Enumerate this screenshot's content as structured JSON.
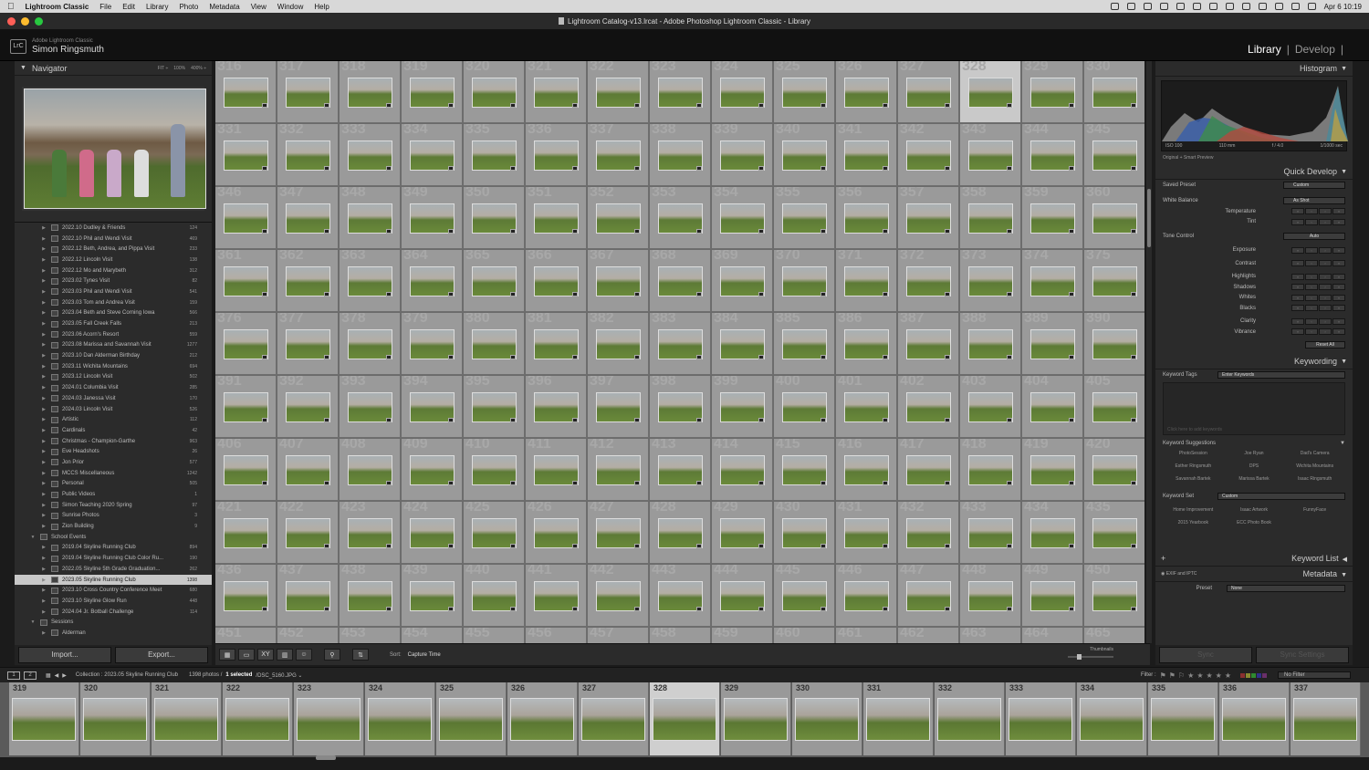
{
  "macbar": {
    "app": "Lightroom Classic",
    "menus": [
      "File",
      "Edit",
      "Library",
      "Photo",
      "Metadata",
      "View",
      "Window",
      "Help"
    ],
    "clock": "Apr 6  10:19"
  },
  "window": {
    "title": "Lightroom Catalog-v13.lrcat - Adobe Photoshop Lightroom Classic - Library"
  },
  "identity": {
    "product": "Adobe Lightroom Classic",
    "user": "Simon Ringsmuth",
    "badge": "LrC"
  },
  "modules": {
    "library": "Library",
    "sep": "|",
    "develop": "Develop",
    "sep2": "|"
  },
  "navigator": {
    "title": "Navigator",
    "zoom": [
      "FIT ÷",
      "100%",
      "400% ÷"
    ]
  },
  "collections": [
    {
      "name": "2022.10 Dudley & Friends",
      "count": "124",
      "level": 1,
      "tri": "▶"
    },
    {
      "name": "2022.10 Phil and Wendi Visit",
      "count": "469",
      "level": 1,
      "tri": "▶"
    },
    {
      "name": "2022.12 Beth, Andrea, and Pippa Visit",
      "count": "233",
      "level": 1,
      "tri": "▶"
    },
    {
      "name": "2022.12 Lincoln Visit",
      "count": "138",
      "level": 1,
      "tri": "▶"
    },
    {
      "name": "2022.12 Mo and Marybeth",
      "count": "312",
      "level": 1,
      "tri": "▶"
    },
    {
      "name": "2023.02 Tynes Visit",
      "count": "82",
      "level": 1,
      "tri": "▶"
    },
    {
      "name": "2023.03 Phil and Wendi Visit",
      "count": "541",
      "level": 1,
      "tri": "▶"
    },
    {
      "name": "2023.03 Tom and Andrea Visit",
      "count": "159",
      "level": 1,
      "tri": "▶"
    },
    {
      "name": "2023.04 Beth and Steve Corning Iowa",
      "count": "566",
      "level": 1,
      "tri": "▶"
    },
    {
      "name": "2023.05 Fall Creek Falls",
      "count": "213",
      "level": 1,
      "tri": "▶"
    },
    {
      "name": "2023.06 Acorn's Resort",
      "count": "559",
      "level": 1,
      "tri": "▶"
    },
    {
      "name": "2023.08 Marissa and Savannah Visit",
      "count": "1277",
      "level": 1,
      "tri": "▶"
    },
    {
      "name": "2023.10 Dan Alderman Birthday",
      "count": "212",
      "level": 1,
      "tri": "▶"
    },
    {
      "name": "2023.11 Wichita Mountains",
      "count": "694",
      "level": 1,
      "tri": "▶"
    },
    {
      "name": "2023.12 Lincoln Visit",
      "count": "502",
      "level": 1,
      "tri": "▶"
    },
    {
      "name": "2024.01 Columbia Visit",
      "count": "285",
      "level": 1,
      "tri": "▶"
    },
    {
      "name": "2024.03 Janessa Visit",
      "count": "170",
      "level": 1,
      "tri": "▶"
    },
    {
      "name": "2024.03 Lincoln Visit",
      "count": "526",
      "level": 1,
      "tri": "▶"
    },
    {
      "name": "Artistic",
      "count": "112",
      "level": 1,
      "tri": "▶"
    },
    {
      "name": "Cardinals",
      "count": "42",
      "level": 1,
      "tri": "▶"
    },
    {
      "name": "Christmas - Champion-Garthe",
      "count": "963",
      "level": 1,
      "tri": "▶"
    },
    {
      "name": "Eve Headshots",
      "count": "26",
      "level": 1,
      "tri": "▶"
    },
    {
      "name": "Jon Prior",
      "count": "577",
      "level": 1,
      "tri": "▶"
    },
    {
      "name": "MCCS Miscellaneous",
      "count": "1242",
      "level": 1,
      "tri": "▶"
    },
    {
      "name": "Personal",
      "count": "505",
      "level": 1,
      "tri": "▶"
    },
    {
      "name": "Public Videos",
      "count": "1",
      "level": 1,
      "tri": "▶"
    },
    {
      "name": "Simon Teaching 2020 Spring",
      "count": "97",
      "level": 1,
      "tri": "▶"
    },
    {
      "name": "Sunrise Photos",
      "count": "3",
      "level": 1,
      "tri": "▶"
    },
    {
      "name": "Zion Building",
      "count": "9",
      "level": 1,
      "tri": "▶"
    },
    {
      "name": "School Events",
      "count": "",
      "level": 0,
      "tri": "▼"
    },
    {
      "name": "2019.04 Skyline Running Club",
      "count": "894",
      "level": 1,
      "tri": "▶"
    },
    {
      "name": "2019.04 Skyline Running Club Color Ru...",
      "count": "190",
      "level": 1,
      "tri": "▶"
    },
    {
      "name": "2022.05 Skyline 5th Grade Graduation...",
      "count": "262",
      "level": 1,
      "tri": "▶"
    },
    {
      "name": "2023.05 Skyline Running Club",
      "count": "1398",
      "level": 1,
      "tri": "▶",
      "selected": true
    },
    {
      "name": "2023.10 Cross Country Conference Meet",
      "count": "680",
      "level": 1,
      "tri": "▶"
    },
    {
      "name": "2023.10 Skyline Glow Run",
      "count": "448",
      "level": 1,
      "tri": "▶"
    },
    {
      "name": "2024.04 Jr. Botball Challenge",
      "count": "114",
      "level": 1,
      "tri": "▶"
    },
    {
      "name": "Sessions",
      "count": "",
      "level": 0,
      "tri": "▼"
    },
    {
      "name": "Alderman",
      "count": "",
      "level": 1,
      "tri": "▶"
    }
  ],
  "left_buttons": {
    "import": "Import...",
    "export": "Export..."
  },
  "grid": {
    "start": 316,
    "cols": 15,
    "rows": 10,
    "selected": 328
  },
  "toolbar": {
    "sort_label": "Sort:",
    "sort_value": "Capture Time",
    "thumbs_label": "Thumbnails"
  },
  "histogram": {
    "title": "Histogram",
    "iso": "ISO 100",
    "focal": "110 mm",
    "aperture": "f / 4.0",
    "shutter": "1/1000 sec",
    "preview": "Original + Smart Preview"
  },
  "quick_develop": {
    "title": "Quick Develop",
    "saved_preset_label": "Saved Preset",
    "saved_preset_value": "Custom",
    "wb_label": "White Balance",
    "wb_value": "As Shot",
    "temperature": "Temperature",
    "tint": "Tint",
    "tone_label": "Tone Control",
    "auto": "Auto",
    "exposure": "Exposure",
    "contrast": "Contrast",
    "highlights": "Highlights",
    "shadows": "Shadows",
    "whites": "Whites",
    "blacks": "Blacks",
    "clarity": "Clarity",
    "vibrance": "Vibrance",
    "reset": "Reset All"
  },
  "keywording": {
    "title": "Keywording",
    "tags_label": "Keyword Tags",
    "tags_value": "Enter Keywords",
    "hint": "Click here to add keywords",
    "suggest_title": "Keyword Suggestions",
    "suggestions": [
      "PhotoSession",
      "Joe Ryan",
      "Dad's Camera",
      "Esther Ringsmuth",
      "DPS",
      "Wichita Mountains",
      "Savannah Bartek",
      "Marissa Bartek",
      "Isaac Ringsmuth"
    ],
    "set_label": "Keyword Set",
    "set_value": "Custom",
    "set_items": [
      "Home Improvement",
      "Isaac Artwork",
      "FunnyFace",
      "2015 Yearbook",
      "ECC Photo Book",
      ""
    ]
  },
  "keyword_list": {
    "title": "Keyword List"
  },
  "metadata": {
    "title": "Metadata",
    "preset_source": "EXIF and IPTC",
    "preset_label": "Preset",
    "preset_value": "None"
  },
  "right_buttons": {
    "sync": "Sync",
    "sync_settings": "Sync Settings"
  },
  "filmbar": {
    "pages": [
      "1",
      "2"
    ],
    "collection": "Collection : 2023.05 Skyline Running Club",
    "count": "1398 photos /",
    "selected": "1 selected",
    "file": "/DSC_5160.JPG ⌄",
    "filter_label": "Filter :",
    "filter_value": "No Filter"
  },
  "filmstrip": {
    "start": 319,
    "count": 19,
    "selected": 328
  }
}
